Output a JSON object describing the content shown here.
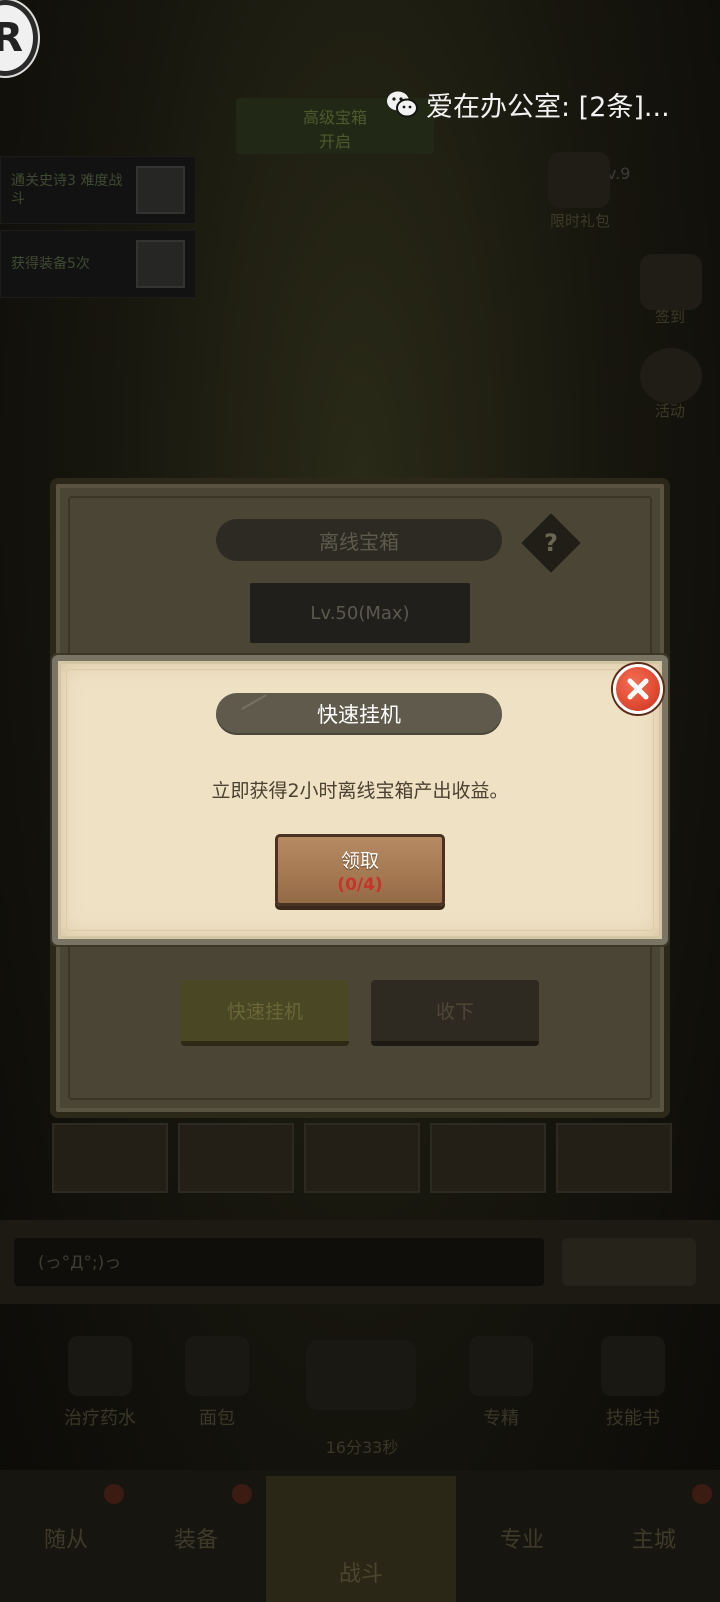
{
  "status": {
    "wechat_notification": "爱在办公室: [2条]..."
  },
  "background": {
    "r_logo": "R",
    "top_banner": "高级宝箱\n开启",
    "quests": [
      {
        "text": "通关史诗3 难度战斗"
      },
      {
        "text": "获得装备5次"
      }
    ],
    "side_labels": [
      "限时礼包",
      "签到",
      "活动"
    ],
    "level_tag": "Lv.9",
    "chest_panel": {
      "title": "离线宝箱",
      "help": "?",
      "level": "Lv.50(Max)",
      "quick_idle_button": "快速挂机",
      "collect_button": "收下"
    },
    "chat_input": "(っ°Д°;)っ",
    "bottom_items": [
      "治疗药水",
      "面包",
      "专精",
      "技能书"
    ],
    "timer": "16分33秒",
    "nav_tabs": [
      "随从",
      "装备",
      "战斗",
      "专业",
      "主城"
    ]
  },
  "popup": {
    "title": "快速挂机",
    "description": "立即获得2小时离线宝箱产出收益。",
    "claim_label": "领取",
    "claim_count": "(0/4)",
    "close_icon": "close-x-icon",
    "colors": {
      "accent_red": "#e04a32",
      "parchment": "#efe2c4",
      "button_wood": "#a57a53"
    }
  }
}
